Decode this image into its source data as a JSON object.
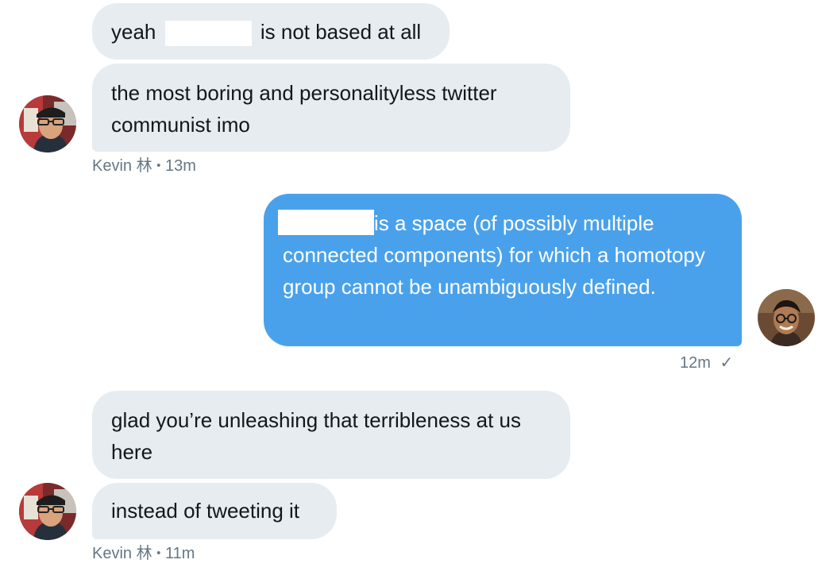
{
  "conversation": {
    "messages": [
      {
        "text_before": "yeah",
        "text_after": "is not based at all"
      },
      {
        "text": "the most boring and personalityless twitter communist imo"
      },
      {
        "meta": {
          "sender": "Kevin 林",
          "separator": "•",
          "time": "13m"
        }
      },
      {
        "text": "is a space (of possibly multiple connected components) for which a homotopy group cannot be unambiguously defined."
      },
      {
        "meta": {
          "time": "12m",
          "status_glyph": "✓"
        }
      },
      {
        "text": "glad you’re unleashing that terribleness at us here"
      },
      {
        "text": "instead of tweeting it"
      },
      {
        "meta": {
          "sender": "Kevin 林",
          "separator": "•",
          "time": "11m"
        }
      }
    ]
  },
  "colors": {
    "received_bubble": "#e6ecf0",
    "sent_bubble": "#4aa1eb",
    "meta_text": "#657786"
  }
}
